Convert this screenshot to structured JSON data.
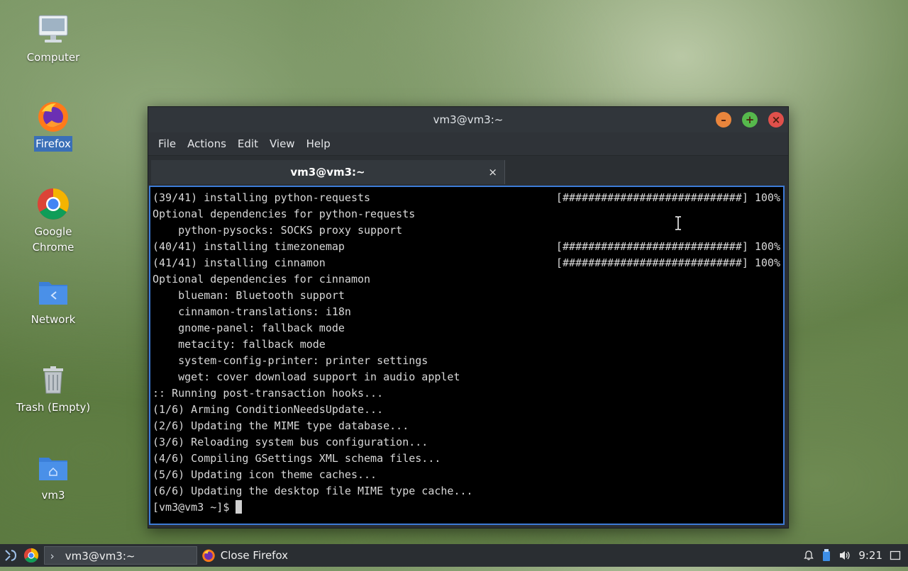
{
  "desktop": {
    "icons": [
      {
        "label": "Computer"
      },
      {
        "label": "Firefox"
      },
      {
        "label": "Google Chrome"
      },
      {
        "label": "Network"
      },
      {
        "label": "Trash (Empty)"
      },
      {
        "label": "vm3"
      }
    ]
  },
  "window": {
    "title": "vm3@vm3:~",
    "menu": [
      "File",
      "Actions",
      "Edit",
      "View",
      "Help"
    ],
    "tab_title": "vm3@vm3:~",
    "tab_close": "×"
  },
  "terminal": {
    "lines": [
      "(39/41) installing python-requests",
      "Optional dependencies for python-requests",
      "    python-pysocks: SOCKS proxy support",
      "(40/41) installing timezonemap",
      "(41/41) installing cinnamon",
      "Optional dependencies for cinnamon",
      "    blueman: Bluetooth support",
      "    cinnamon-translations: i18n",
      "    gnome-panel: fallback mode",
      "    metacity: fallback mode",
      "    system-config-printer: printer settings",
      "    wget: cover download support in audio applet",
      ":: Running post-transaction hooks...",
      "(1/6) Arming ConditionNeedsUpdate...",
      "(2/6) Updating the MIME type database...",
      "(3/6) Reloading system bus configuration...",
      "(4/6) Compiling GSettings XML schema files...",
      "(5/6) Updating icon theme caches...",
      "(6/6) Updating the desktop file MIME type cache..."
    ],
    "progress_bar": "[############################] 100%",
    "prompt": "[vm3@vm3 ~]$ "
  },
  "taskbar": {
    "tasks": [
      {
        "label": "vm3@vm3:~"
      },
      {
        "label": "Close Firefox"
      }
    ],
    "clock": "9:21"
  },
  "colors": {
    "accent": "#3d7bd6",
    "minimize": "#e9853c",
    "maximize": "#56b84c",
    "close": "#e0504b"
  }
}
